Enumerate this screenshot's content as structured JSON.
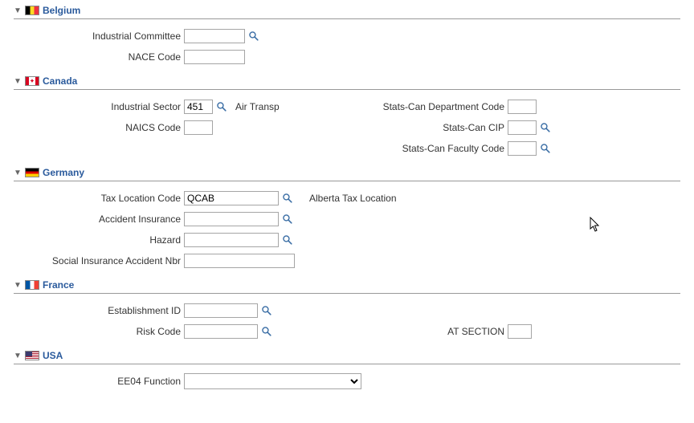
{
  "sections": {
    "belgium": {
      "title": "Belgium"
    },
    "canada": {
      "title": "Canada"
    },
    "germany": {
      "title": "Germany"
    },
    "france": {
      "title": "France"
    },
    "usa": {
      "title": "USA"
    }
  },
  "belgium": {
    "industrial_committee_label": "Industrial Committee",
    "industrial_committee_value": "",
    "nace_code_label": "NACE Code",
    "nace_code_value": ""
  },
  "canada": {
    "industrial_sector_label": "Industrial Sector",
    "industrial_sector_value": "451",
    "industrial_sector_desc": "Air Transp",
    "naics_code_label": "NAICS Code",
    "naics_code_value": "",
    "stats_can_dept_label": "Stats-Can Department Code",
    "stats_can_dept_value": "",
    "stats_can_cip_label": "Stats-Can CIP",
    "stats_can_cip_value": "",
    "stats_can_faculty_label": "Stats-Can Faculty Code",
    "stats_can_faculty_value": ""
  },
  "germany": {
    "tax_location_label": "Tax Location Code",
    "tax_location_value": "QCAB",
    "tax_location_desc": "Alberta Tax Location",
    "accident_insurance_label": "Accident Insurance",
    "accident_insurance_value": "",
    "hazard_label": "Hazard",
    "hazard_value": "",
    "social_ins_accident_nbr_label": "Social Insurance Accident Nbr",
    "social_ins_accident_nbr_value": ""
  },
  "france": {
    "establishment_id_label": "Establishment ID",
    "establishment_id_value": "",
    "risk_code_label": "Risk Code",
    "risk_code_value": "",
    "at_section_label": "AT SECTION",
    "at_section_value": ""
  },
  "usa": {
    "ee04_function_label": "EE04 Function",
    "ee04_function_value": ""
  }
}
